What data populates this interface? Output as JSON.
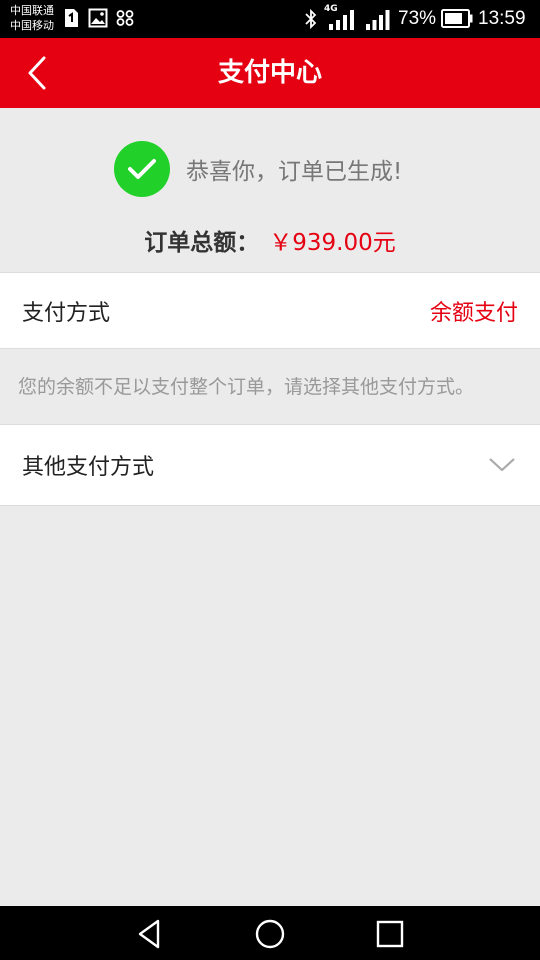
{
  "status_bar": {
    "carrier_1": "中国联通",
    "carrier_2": "中国移动",
    "network_type": "4G",
    "battery_percent": "73%",
    "time": "13:59",
    "icons": [
      "sim-card-icon",
      "image-icon",
      "voicemail-icon",
      "bluetooth-icon",
      "signal-4g-icon",
      "signal-icon",
      "battery-icon"
    ]
  },
  "header": {
    "title": "支付中心",
    "back_icon": "back-arrow-icon"
  },
  "success": {
    "icon": "check-circle-icon",
    "message": "恭喜你，订单已生成!"
  },
  "order_total": {
    "label": "订单总额：",
    "value": "￥939.00元"
  },
  "payment_method": {
    "label": "支付方式",
    "value": "余额支付"
  },
  "notice": "您的余额不足以支付整个订单，请选择其他支付方式。",
  "other_payment": {
    "label": "其他支付方式",
    "icon": "chevron-down-icon"
  },
  "colors": {
    "brand_red": "#e50012",
    "success_green": "#22d02a",
    "background": "#ebebeb"
  },
  "nav_bar": {
    "icons": [
      "nav-back-icon",
      "nav-home-icon",
      "nav-recents-icon"
    ]
  }
}
